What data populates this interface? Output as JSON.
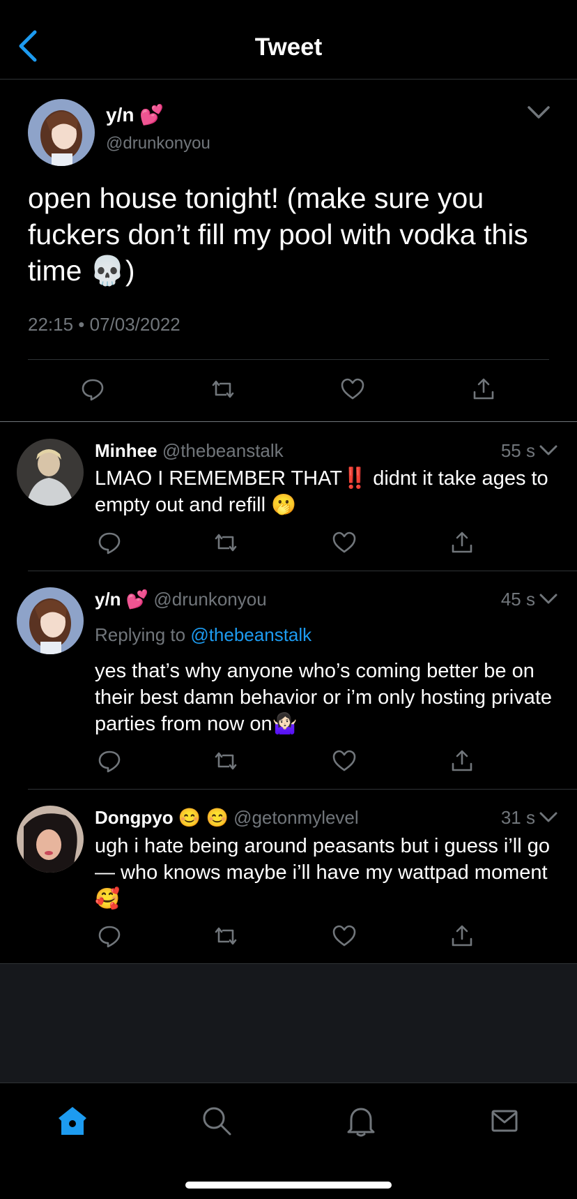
{
  "header": {
    "title": "Tweet"
  },
  "main_tweet": {
    "name": "y/n 💕",
    "handle": "@drunkonyou",
    "text": "open house tonight! (make sure you fuckers don’t fill my pool with vodka this time 💀)",
    "timestamp": "22:15 • 07/03/2022"
  },
  "replies": [
    {
      "name": "Minhee",
      "handle": "@thebeanstalk",
      "time": "55 s",
      "text": "LMAO I REMEMBER THAT‼️ didnt it take ages to empty out and refill 🫢"
    },
    {
      "name": "y/n 💕",
      "handle": "@drunkonyou",
      "time": "45 s",
      "replying_prefix": "Replying to ",
      "replying_to": "@thebeanstalk",
      "text": "yes that’s why anyone who’s coming better be on their best damn behavior or i’m only hosting private parties from now on🤷🏻‍♀️"
    },
    {
      "name": "Dongpyo 😊 😊",
      "handle": "@getonmylevel",
      "time": "31 s",
      "text": "ugh i hate being around peasants but i guess i’ll go— who knows maybe i’ll have my wattpad moment 🥰"
    }
  ],
  "colors": {
    "accent": "#1d9bf0",
    "muted": "#71767b",
    "divider": "#2f3336",
    "background": "#000000"
  },
  "icons": [
    "back-chevron-icon",
    "chevron-down-icon",
    "reply-icon",
    "retweet-icon",
    "like-icon",
    "share-icon",
    "home-icon",
    "search-icon",
    "notifications-icon",
    "messages-icon"
  ]
}
